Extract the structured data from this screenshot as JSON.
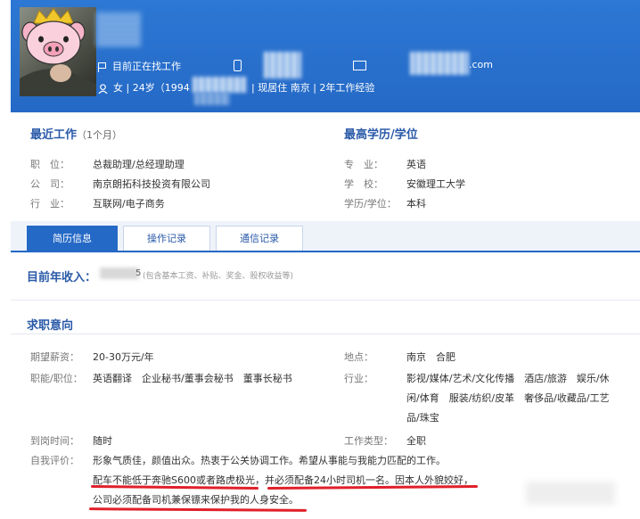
{
  "header": {
    "status": "目前正在找工作",
    "email_suffix": ".com",
    "profile": "女 | 24岁（1994",
    "profile_tail": "| 现居住 南京 | 2年工作经验"
  },
  "recent_work": {
    "title": "最近工作",
    "duration": "（1个月）",
    "fields": [
      {
        "label": "职　位：",
        "value": "总裁助理/总经理助理"
      },
      {
        "label": "公　司：",
        "value": "南京朗拓科技投资有限公司"
      },
      {
        "label": "行　业：",
        "value": "互联网/电子商务"
      }
    ]
  },
  "education": {
    "title": "最高学历/学位",
    "fields": [
      {
        "label": "专　业：",
        "value": "英语"
      },
      {
        "label": "学　校：",
        "value": "安徽理工大学"
      },
      {
        "label": "学历/学位：",
        "value": "本科"
      }
    ]
  },
  "tabs": [
    {
      "label": "简历信息",
      "active": true
    },
    {
      "label": "操作记录",
      "active": false
    },
    {
      "label": "通信记录",
      "active": false
    }
  ],
  "income": {
    "label": "目前年收入：",
    "suffix": "5",
    "note": "(包含基本工资、补贴、奖金、股权收益等)"
  },
  "intent": {
    "title": "求职意向",
    "salary_label": "期望薪资：",
    "salary_value": "20-30万元/年",
    "location_label": "地点：",
    "location_value": "南京　合肥",
    "function_label": "职能/职位：",
    "function_value": "英语翻译　企业秘书/董事会秘书　董事长秘书",
    "industry_label": "行业：",
    "industry_lines": [
      "影视/媒体/艺术/文化传播　酒店/旅游　娱乐/休",
      "闲/体育　服装/纺织/皮革　奢侈品/收藏品/工艺",
      "品/珠宝"
    ],
    "start_label": "到岗时间：",
    "start_value": "随时",
    "type_label": "工作类型：",
    "type_value": "全职",
    "eval_label": "自我评价：",
    "eval_lines": [
      "形象气质佳，颜值出众。热衷于公关协调工作。希望从事能与我能力匹配的工作。",
      "配车不能低于奔驰S600或者路虎极光，并必须配备24小时司机一名。因本人外貌姣好，",
      "公司必须配备司机兼保镖来保护我的人身安全。"
    ]
  },
  "colors": {
    "header": "#2569c6",
    "accent": "#2a5aa8",
    "underline": "#e0202a"
  }
}
